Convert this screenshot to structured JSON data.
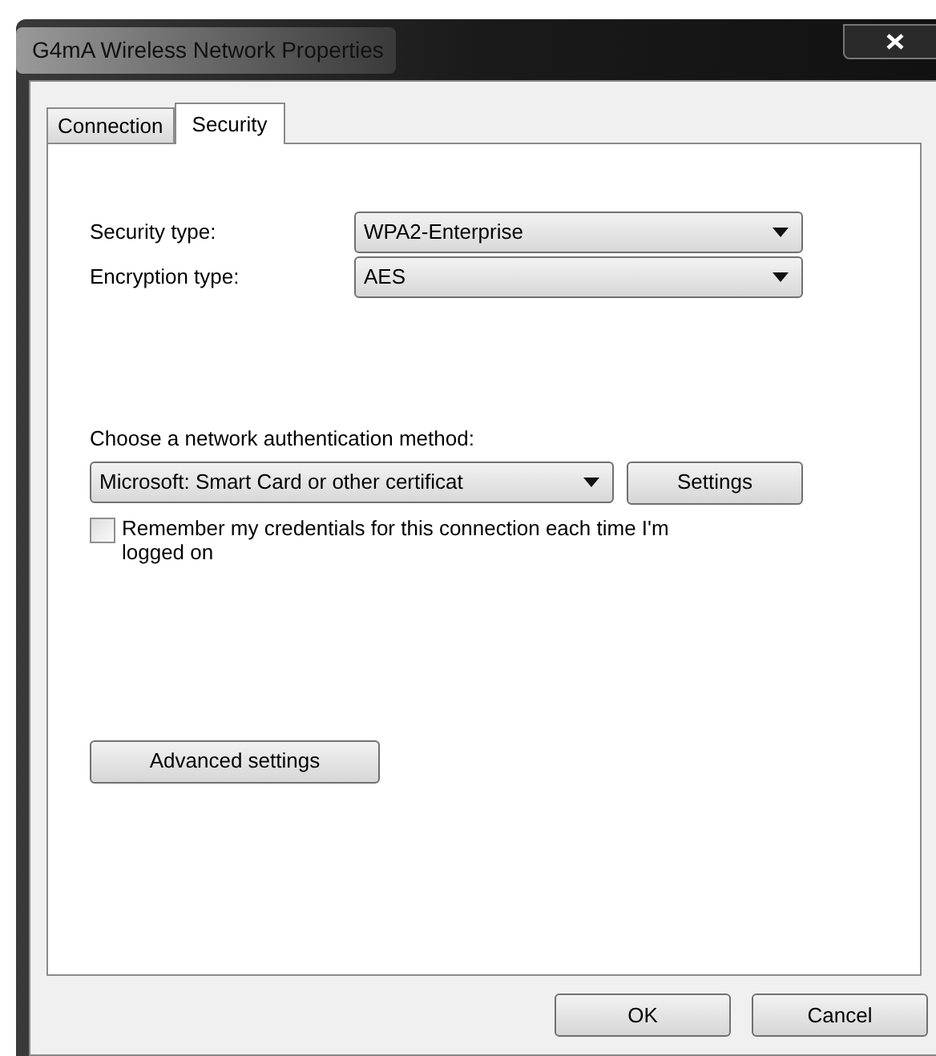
{
  "window": {
    "title": "G4mA Wireless Network Properties"
  },
  "tabs": [
    {
      "label": "Connection",
      "selected": false
    },
    {
      "label": "Security",
      "selected": true
    }
  ],
  "fields": [
    {
      "label": "Security type:",
      "value": "WPA2-Enterprise"
    },
    {
      "label": "Encryption type:",
      "value": "AES"
    }
  ],
  "authentication": {
    "label": "Choose a network authentication method:",
    "method": "Microsoft: Smart Card or other certificat",
    "settings_button": "Settings"
  },
  "remember_credentials": {
    "label": "Remember my credentials for this connection each time I'm logged on",
    "checked": false
  },
  "advanced_button": "Advanced settings",
  "buttons": [
    "OK",
    "Cancel"
  ]
}
